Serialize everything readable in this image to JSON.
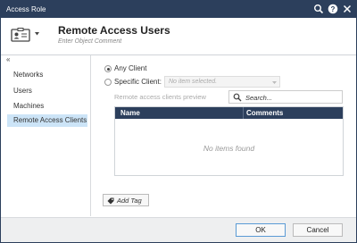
{
  "window": {
    "title": "Access Role"
  },
  "titlebar_icons": [
    "search-icon",
    "help-icon",
    "close-icon"
  ],
  "header": {
    "name": "Remote Access Users",
    "comment_placeholder": "Enter Object Comment"
  },
  "sidebar": {
    "collapse_glyph": "«",
    "items": [
      {
        "label": "Networks",
        "active": false
      },
      {
        "label": "Users",
        "active": false
      },
      {
        "label": "Machines",
        "active": false
      },
      {
        "label": "Remote Access Clients",
        "active": true
      }
    ]
  },
  "clients": {
    "any_label": "Any Client",
    "specific_label": "Specific Client:",
    "selected": "any",
    "select_placeholder": "No item selected.",
    "preview_label": "Remote access clients preview",
    "search_placeholder": "Search...",
    "table": {
      "columns": [
        "Name",
        "Comments"
      ],
      "rows": [],
      "empty_text": "No items found"
    }
  },
  "tags": {
    "add_label": "Add Tag"
  },
  "footer": {
    "ok_label": "OK",
    "cancel_label": "Cancel"
  },
  "colors": {
    "titlebar": "#2c3f5c",
    "active_nav": "#cce4f7",
    "footer": "#eeeff0"
  }
}
